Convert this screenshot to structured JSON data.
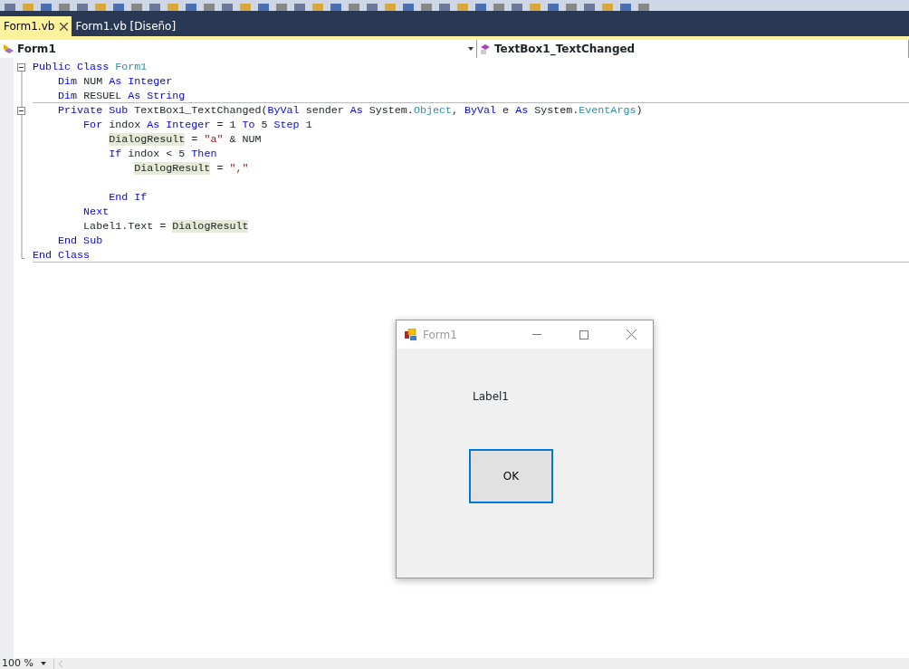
{
  "tabs": [
    {
      "label": "Form1.vb",
      "selected": true,
      "closable": true
    },
    {
      "label": "Form1.vb [Diseño]",
      "selected": false,
      "closable": false
    }
  ],
  "navigation": {
    "class_dropdown": "Form1",
    "member_dropdown": "TextBox1_TextChanged"
  },
  "code_lines": [
    {
      "fold": true,
      "separator": false,
      "tokens": [
        {
          "kind": "kw",
          "text": "Public Class "
        },
        {
          "kind": "type",
          "text": "Form1"
        }
      ]
    },
    {
      "fold": false,
      "separator": false,
      "tokens": [
        {
          "kind": "kw",
          "text": "    Dim "
        },
        {
          "kind": "plain",
          "text": "NUM "
        },
        {
          "kind": "kw",
          "text": "As Integer"
        }
      ]
    },
    {
      "fold": false,
      "separator": true,
      "tokens": [
        {
          "kind": "kw",
          "text": "    Dim "
        },
        {
          "kind": "plain",
          "text": "RESUEL "
        },
        {
          "kind": "kw",
          "text": "As String"
        }
      ]
    },
    {
      "fold": true,
      "separator": false,
      "tokens": [
        {
          "kind": "kw",
          "text": "    Private Sub "
        },
        {
          "kind": "plain",
          "text": "TextBox1_TextChanged("
        },
        {
          "kind": "kw",
          "text": "ByVal "
        },
        {
          "kind": "plain",
          "text": "sender "
        },
        {
          "kind": "kw",
          "text": "As "
        },
        {
          "kind": "plain",
          "text": "System."
        },
        {
          "kind": "type",
          "text": "Object"
        },
        {
          "kind": "plain",
          "text": ", "
        },
        {
          "kind": "kw",
          "text": "ByVal "
        },
        {
          "kind": "plain",
          "text": "e "
        },
        {
          "kind": "kw",
          "text": "As "
        },
        {
          "kind": "plain",
          "text": "System."
        },
        {
          "kind": "type",
          "text": "EventArgs"
        },
        {
          "kind": "plain",
          "text": ")"
        }
      ]
    },
    {
      "fold": false,
      "separator": false,
      "tokens": [
        {
          "kind": "kw",
          "text": "        For "
        },
        {
          "kind": "plain",
          "text": "indox "
        },
        {
          "kind": "kw",
          "text": "As Integer "
        },
        {
          "kind": "plain",
          "text": "= 1 "
        },
        {
          "kind": "kw",
          "text": "To "
        },
        {
          "kind": "plain",
          "text": "5 "
        },
        {
          "kind": "kw",
          "text": "Step "
        },
        {
          "kind": "plain",
          "text": "1"
        }
      ]
    },
    {
      "fold": false,
      "separator": false,
      "tokens": [
        {
          "kind": "hl",
          "text": "            DialogResult"
        },
        {
          "kind": "plain",
          "text": " = "
        },
        {
          "kind": "str",
          "text": "\"a\""
        },
        {
          "kind": "plain",
          "text": " & NUM"
        }
      ]
    },
    {
      "fold": false,
      "separator": false,
      "tokens": [
        {
          "kind": "kw",
          "text": "            If "
        },
        {
          "kind": "plain",
          "text": "indox < 5 "
        },
        {
          "kind": "kw",
          "text": "Then"
        }
      ]
    },
    {
      "fold": false,
      "separator": false,
      "tokens": [
        {
          "kind": "hl",
          "text": "                DialogResult"
        },
        {
          "kind": "plain",
          "text": " = "
        },
        {
          "kind": "str",
          "text": "\",\""
        }
      ]
    },
    {
      "fold": false,
      "separator": false
    },
    {
      "fold": false,
      "separator": false,
      "tokens": [
        {
          "kind": "kw",
          "text": "            End If"
        }
      ]
    },
    {
      "fold": false,
      "separator": false,
      "tokens": [
        {
          "kind": "kw",
          "text": "        Next"
        }
      ]
    },
    {
      "fold": false,
      "separator": false,
      "tokens": [
        {
          "kind": "plain",
          "text": "        Label1.Text = "
        },
        {
          "kind": "hl",
          "text": "DialogResult"
        }
      ]
    },
    {
      "fold": false,
      "separator": false,
      "tokens": [
        {
          "kind": "kw",
          "text": "    End Sub"
        }
      ]
    },
    {
      "fold": false,
      "separator": true,
      "tokens": [
        {
          "kind": "kw",
          "text": "End Class"
        }
      ]
    }
  ],
  "form_window": {
    "title": "Form1",
    "label": "Label1",
    "button": "OK",
    "button_focused": true
  },
  "status_bar": {
    "zoom": "100 %"
  }
}
